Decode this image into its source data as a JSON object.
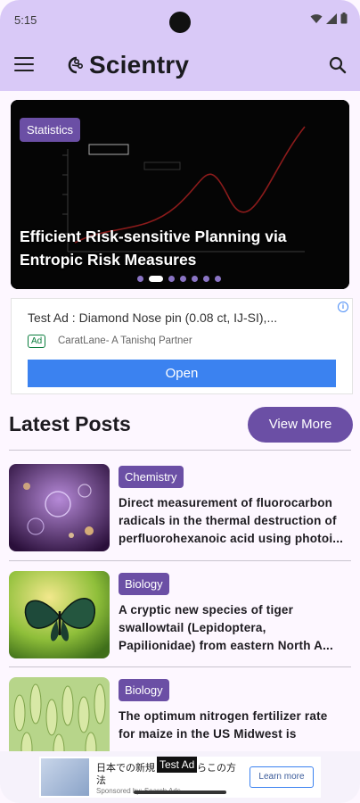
{
  "status_bar": {
    "time": "5:15"
  },
  "app_bar": {
    "title": "Scientry"
  },
  "carousel": {
    "category": "Statistics",
    "title": "Efficient Risk-sensitive Planning via Entropic Risk Measures",
    "slide_count": 7,
    "active_slide": 1
  },
  "ad": {
    "title": "Test Ad : Diamond Nose pin (0.08 ct, IJ-SI),...",
    "badge": "Ad",
    "advertiser": "CaratLane- A Tanishq Partner",
    "cta": "Open"
  },
  "latest": {
    "heading": "Latest Posts",
    "view_more": "View More"
  },
  "posts": [
    {
      "category": "Chemistry",
      "lines": [
        "Direct measurement of fluorocarbon",
        "radicals in the thermal destruction of",
        "perfluorohexanoic acid using photoi..."
      ]
    },
    {
      "category": "Biology",
      "lines": [
        "A cryptic new species of tiger",
        "swallowtail (Lepidoptera,",
        "Papilionidae) from eastern North A..."
      ]
    },
    {
      "category": "Biology",
      "lines": [
        "The optimum nitrogen fertilizer rate",
        "for maize in the US Midwest is",
        "..."
      ]
    }
  ],
  "bottom_ad": {
    "label": "Test Ad",
    "text": "日本での新規 したいならこの方法",
    "sponsor": "Sponsored by: Search Ads",
    "cta": "Learn more"
  },
  "colors": {
    "app_bar": "#d9c9f7",
    "accent": "#6b4fa5",
    "ad_button": "#3b82f0"
  }
}
